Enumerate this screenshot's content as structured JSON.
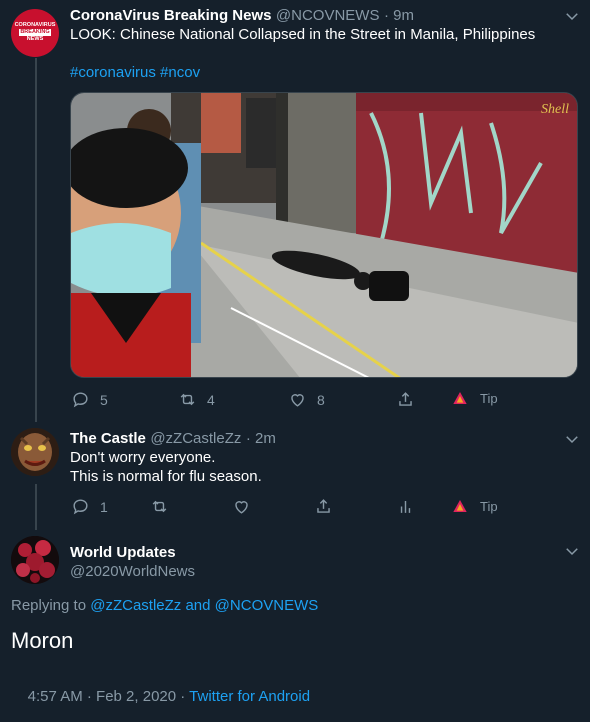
{
  "tweet1": {
    "name": "CoronaVirus Breaking News",
    "handle": "@NCOVNEWS",
    "time": "· 9m",
    "avatar_text": [
      "CORONAVIRUS",
      "BREAKING",
      "NEWS"
    ],
    "text": "LOOK: Chinese National Collapsed in the Street in Manila, Philippines",
    "hashtags": "#coronavirus #ncov",
    "graffiti": "Shell",
    "actions": {
      "replies": "5",
      "retweets": "4",
      "likes": "8",
      "tip": "Tip"
    }
  },
  "tweet2": {
    "name": "The Castle",
    "handle": "@zZCastleZz",
    "time": "· 2m",
    "line1": "Don't worry everyone.",
    "line2": "This is normal for flu season.",
    "actions": {
      "replies": "1",
      "tip": "Tip"
    }
  },
  "tweet3": {
    "name": "World Updates",
    "handle": "@2020WorldNews",
    "replying_prefix": "Replying to",
    "replying_user1": "@zZCastleZz",
    "replying_and": "and",
    "replying_user2": "@NCOVNEWS",
    "text": "Moron",
    "timestamp": "4:57 AM · Feb 2, 2020 · ",
    "source": "Twitter for Android"
  },
  "colors": {
    "background": "#15202b",
    "secondary_text": "#8899a6",
    "link": "#1da1f2",
    "divider": "#38444d",
    "tip_icon": "#e0245e"
  },
  "icons": [
    "chevron-down-icon",
    "reply-icon",
    "retweet-icon",
    "like-icon",
    "share-icon",
    "analytics-icon",
    "tip-icon"
  ]
}
